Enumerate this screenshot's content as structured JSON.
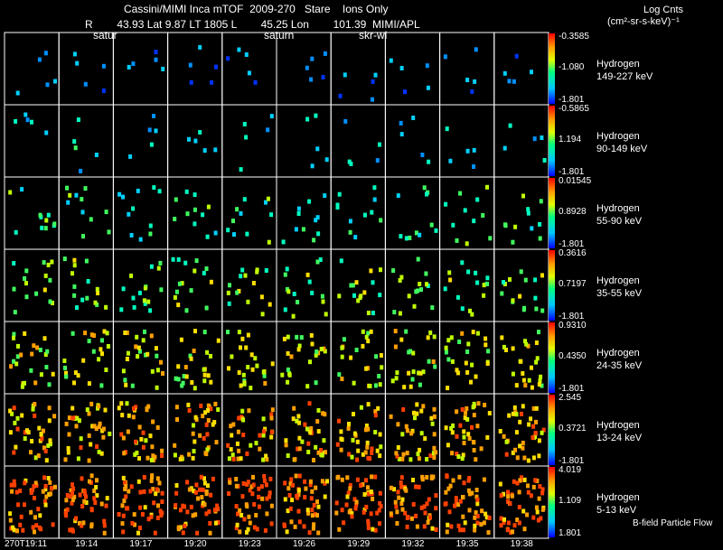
{
  "header": {
    "title": "Cassini/MIMI Inca mTOF  2009-270   Stare    Ions Only",
    "ephemeris": "R        43.93 Lat 9.87 LT 1805 L        45.25 Lon        101.39  MIMI/APL",
    "cb_units_1": "Log Cnts",
    "cb_units_2": "(cm²-sr-s-keV)⁻¹"
  },
  "overlay_labels": [
    "satur",
    "saturn",
    "skr-wi"
  ],
  "footer_note": "B-field Particle Flow",
  "chart_data": {
    "type": "heatmap",
    "x_tick_labels": [
      "270T19:11",
      "19:14",
      "19:17",
      "19:20",
      "19:23",
      "19:26",
      "19:29",
      "19:32",
      "19:35",
      "19:38"
    ],
    "rows": [
      {
        "species": "Hydrogen",
        "energy": "149-227 keV",
        "cb_max": "-0.3585",
        "cb_mid": "-1.080",
        "cb_min": "-1.801",
        "fill_level": 0.05
      },
      {
        "species": "Hydrogen",
        "energy": "90-149 keV",
        "cb_max": "-0.5865",
        "cb_mid": "1.194",
        "cb_min": "-1.801",
        "fill_level": 0.05
      },
      {
        "species": "Hydrogen",
        "energy": "55-90 keV",
        "cb_max": "0.01545",
        "cb_mid": "0.8928",
        "cb_min": "-1.801",
        "fill_level": 0.12
      },
      {
        "species": "Hydrogen",
        "energy": "35-55 keV",
        "cb_max": "0.3616",
        "cb_mid": "0.7197",
        "cb_min": "-1.801",
        "fill_level": 0.18
      },
      {
        "species": "Hydrogen",
        "energy": "24-35 keV",
        "cb_max": "0.9310",
        "cb_mid": "0.4350",
        "cb_min": "-1.801",
        "fill_level": 0.28
      },
      {
        "species": "Hydrogen",
        "energy": "13-24 keV",
        "cb_max": "2.545",
        "cb_mid": "0.3721",
        "cb_min": "-1.801",
        "fill_level": 0.42
      },
      {
        "species": "Hydrogen",
        "energy": "5-13 keV",
        "cb_max": "4.019",
        "cb_mid": "1.109",
        "cb_min": "1.801",
        "fill_level": 0.55
      }
    ],
    "grid": true
  }
}
